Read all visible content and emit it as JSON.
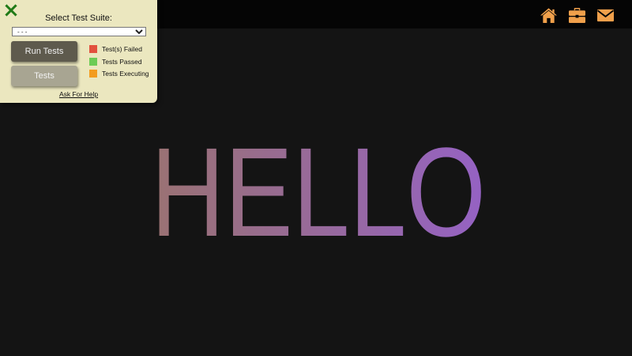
{
  "nav": {
    "icons": [
      "home-icon",
      "briefcase-icon",
      "mail-icon"
    ],
    "icon_color": "#f0a04b"
  },
  "hero": {
    "text": "HELLO",
    "gradient_start": "#9a7272",
    "gradient_end": "#9562c4"
  },
  "panel": {
    "title": "Select Test Suite:",
    "select_value": "- - -",
    "run_tests_label": "Run Tests",
    "tests_label": "Tests",
    "legend": [
      {
        "label": "Test(s) Failed",
        "color": "#e2513e"
      },
      {
        "label": "Tests Passed",
        "color": "#6ccc55"
      },
      {
        "label": "Tests Executing",
        "color": "#f39c1f"
      }
    ],
    "help_label": "Ask For Help",
    "close_icon_color": "#1f7a16"
  }
}
